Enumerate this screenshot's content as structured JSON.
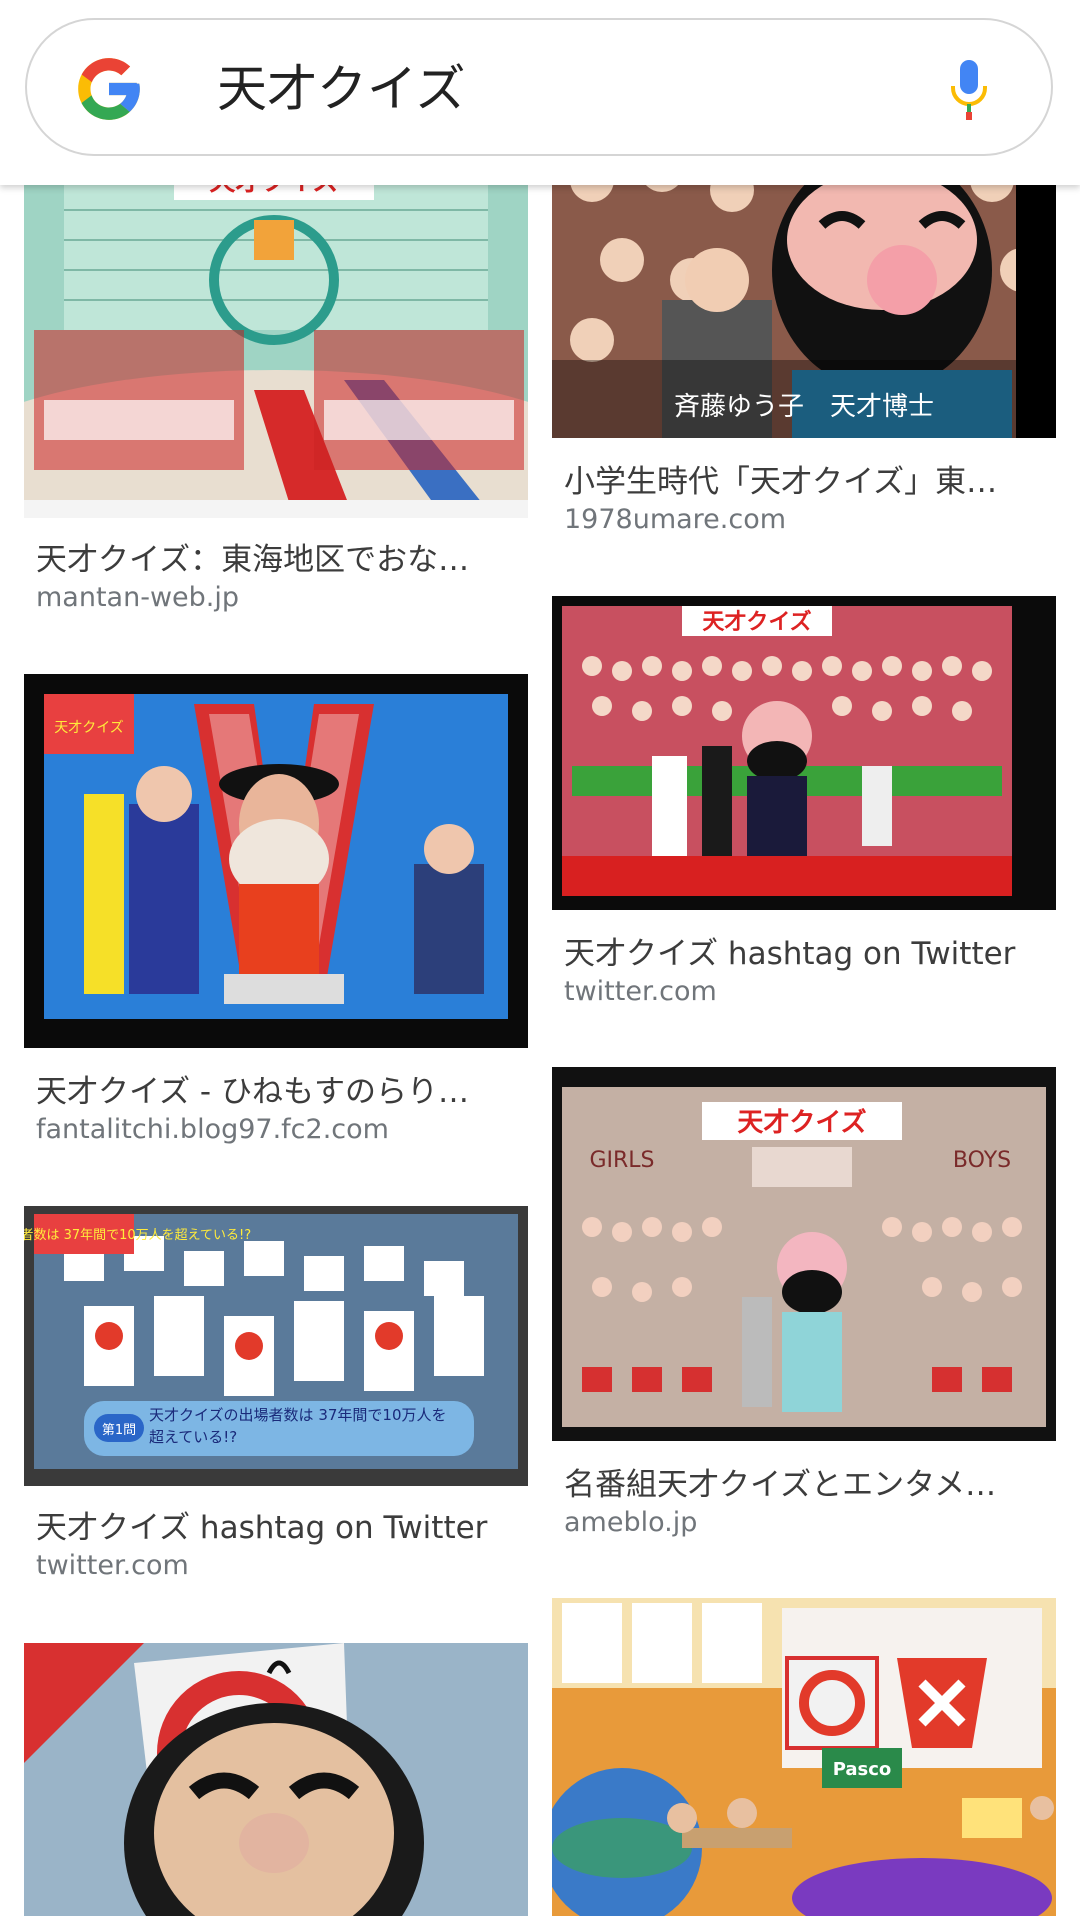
{
  "search": {
    "query": "天才クイズ",
    "logo_icon": "google-g-icon",
    "mic_icon": "microphone-icon"
  },
  "colors": {
    "google_blue": "#4285F4",
    "google_red": "#EA4335",
    "google_yellow": "#FBBC05",
    "google_green": "#34A853",
    "title_text": "#3c3c3c",
    "source_text": "#70757a"
  },
  "results": [
    {
      "title": "天才クイズ：東海地区でおな…",
      "source": "mantan-web.jp",
      "image_text": "天才クイズ"
    },
    {
      "title": "小学生時代「天才クイズ」東…",
      "source": "1978umare.com",
      "image_text": "斉藤ゆう子　天才博士"
    },
    {
      "title": "天才クイズ - ひねもすのらり…",
      "source": "fantalitchi.blog97.fc2.com",
      "image_text": "天才クイズ"
    },
    {
      "title": "天才クイズ hashtag on Twitter",
      "source": "twitter.com",
      "image_text": "天才クイズ"
    },
    {
      "title": "天才クイズ hashtag on Twitter",
      "source": "twitter.com",
      "image_text": "天才クイズの出場者数は 37年間で10万人を超えている!?",
      "image_badge": "第1問"
    },
    {
      "title": "名番組天才クイズとエンタメ…",
      "source": "ameblo.jp",
      "image_text": "天才クイズ",
      "image_text_left": "GIRLS",
      "image_text_right": "BOYS"
    },
    {
      "title": "",
      "source": ""
    },
    {
      "title": "",
      "source": "",
      "image_text": "Pasco"
    }
  ]
}
